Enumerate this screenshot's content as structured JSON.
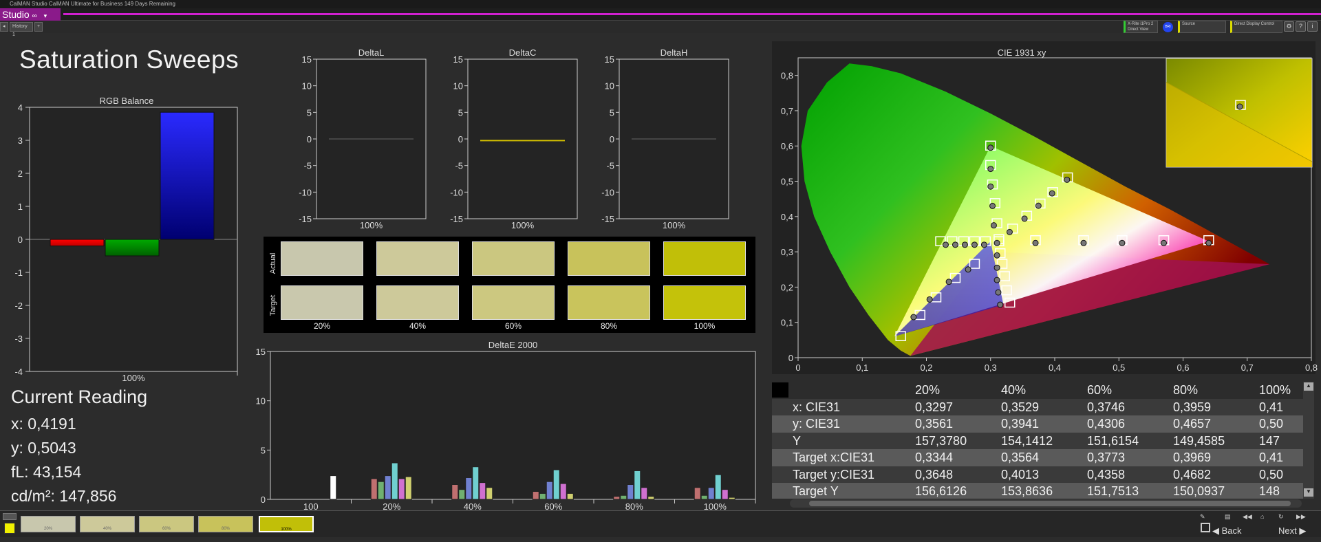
{
  "window": {
    "title": "CalMAN Studio CalMAN Ultimate for Business 149 Days Remaining",
    "app_label": "Studio",
    "history_tab": "History 1",
    "add_tab": "+"
  },
  "toolbar": {
    "meter": "X-Rite i1Pro 2",
    "meter_view": "Direct View",
    "source": "Source",
    "display": "Direct Display Control",
    "meter_badge": "BRI",
    "colors": {
      "meter": "#33cc33",
      "source": "#dddd00",
      "display": "#dddd00",
      "badge": "#2244ee"
    }
  },
  "page_title": "Saturation Sweeps",
  "current_reading": {
    "heading": "Current Reading",
    "x": "x: 0,4191",
    "y": "y: 0,5043",
    "fL": "fL: 43,154",
    "cdm2": "cd/m²: 147,856"
  },
  "swatch_labels": {
    "actual": "Actual",
    "target": "Target"
  },
  "charts": {
    "rgb": {
      "title": "RGB Balance",
      "yticks": [
        "4",
        "3",
        "2",
        "1",
        "0",
        "-1",
        "-2",
        "-3",
        "-4"
      ],
      "xlabel": "100%"
    },
    "deltaL": {
      "title": "DeltaL",
      "xlabel": "100%"
    },
    "deltaC": {
      "title": "DeltaC",
      "xlabel": "100%"
    },
    "deltaH": {
      "title": "DeltaH",
      "xlabel": "100%"
    },
    "deltaE": {
      "title": "DeltaE 2000",
      "yticks": [
        "15",
        "10",
        "5",
        "0"
      ],
      "xlabels": [
        "100",
        "20%",
        "40%",
        "60%",
        "80%",
        "100%"
      ]
    },
    "cie": {
      "title": "CIE 1931 xy",
      "xticks": [
        "0",
        "0,1",
        "0,2",
        "0,3",
        "0,4",
        "0,5",
        "0,6",
        "0,7",
        "0,8"
      ],
      "yticks": [
        "0,8",
        "0,7",
        "0,6",
        "0,5",
        "0,4",
        "0,3",
        "0,2",
        "0,1",
        "0"
      ]
    },
    "dticks": [
      "15",
      "10",
      "5",
      "0",
      "-5",
      "-10",
      "-15"
    ]
  },
  "chart_data": [
    {
      "type": "bar",
      "title": "RGB Balance",
      "categories": [
        "Red",
        "Green",
        "Blue"
      ],
      "values": [
        -0.2,
        -0.5,
        3.85
      ],
      "colors": [
        "#ff0000",
        "#00a000",
        "#0000ff"
      ],
      "ylim": [
        -4,
        4
      ],
      "xlabel": "100%"
    },
    {
      "type": "line",
      "title": "DeltaL",
      "x": [
        "100%"
      ],
      "values": [
        0
      ],
      "ylim": [
        -15,
        15
      ]
    },
    {
      "type": "line",
      "title": "DeltaC",
      "x": [
        "100%"
      ],
      "values": [
        -0.3
      ],
      "ylim": [
        -15,
        15
      ],
      "color": "#d4c000"
    },
    {
      "type": "line",
      "title": "DeltaH",
      "x": [
        "100%"
      ],
      "values": [
        0
      ],
      "ylim": [
        -15,
        15
      ]
    },
    {
      "type": "bar",
      "title": "DeltaE 2000",
      "categories": [
        "100",
        "20%",
        "40%",
        "60%",
        "80%",
        "100%"
      ],
      "ylim": [
        0,
        15
      ],
      "series": [
        {
          "color": "#ffffff",
          "values": [
            2.4,
            null,
            null,
            null,
            null,
            null
          ]
        },
        {
          "color": "#c07070",
          "values": [
            null,
            2.1,
            1.5,
            0.8,
            0.3,
            1.2
          ]
        },
        {
          "color": "#70b070",
          "values": [
            null,
            1.8,
            1.0,
            0.6,
            0.4,
            0.4
          ]
        },
        {
          "color": "#7080d0",
          "values": [
            null,
            2.4,
            2.2,
            1.8,
            1.5,
            1.2
          ]
        },
        {
          "color": "#70d0d0",
          "values": [
            null,
            3.7,
            3.3,
            3.0,
            2.9,
            2.5
          ]
        },
        {
          "color": "#d070d0",
          "values": [
            null,
            2.1,
            1.7,
            1.6,
            1.2,
            1.0
          ]
        },
        {
          "color": "#d0d070",
          "values": [
            null,
            2.3,
            1.2,
            0.6,
            0.3,
            0.2
          ]
        }
      ]
    },
    {
      "type": "scatter",
      "title": "CIE 1931 xy",
      "xlim": [
        0,
        0.8
      ],
      "ylim": [
        0,
        0.85
      ],
      "inset": "zoomed view around the current measured point",
      "current": {
        "x": 0.4191,
        "y": 0.5043
      },
      "targets": [
        [
          0.3,
          0.6
        ],
        [
          0.3,
          0.545
        ],
        [
          0.303,
          0.49
        ],
        [
          0.307,
          0.437
        ],
        [
          0.31,
          0.38
        ],
        [
          0.313,
          0.335
        ],
        [
          0.16,
          0.06
        ],
        [
          0.19,
          0.12
        ],
        [
          0.215,
          0.17
        ],
        [
          0.245,
          0.225
        ],
        [
          0.275,
          0.265
        ],
        [
          0.222,
          0.329
        ],
        [
          0.24,
          0.329
        ],
        [
          0.258,
          0.329
        ],
        [
          0.275,
          0.329
        ],
        [
          0.292,
          0.329
        ],
        [
          0.313,
          0.329
        ],
        [
          0.37,
          0.332
        ],
        [
          0.445,
          0.332
        ],
        [
          0.505,
          0.332
        ],
        [
          0.57,
          0.332
        ],
        [
          0.64,
          0.332
        ],
        [
          0.33,
          0.155
        ],
        [
          0.325,
          0.19
        ],
        [
          0.322,
          0.23
        ],
        [
          0.318,
          0.265
        ],
        [
          0.315,
          0.295
        ],
        [
          0.3344,
          0.3648
        ],
        [
          0.3564,
          0.4013
        ],
        [
          0.3773,
          0.4358
        ],
        [
          0.3969,
          0.4682
        ],
        [
          0.42,
          0.51
        ]
      ],
      "measured": [
        [
          0.3,
          0.595
        ],
        [
          0.3,
          0.535
        ],
        [
          0.3,
          0.485
        ],
        [
          0.303,
          0.43
        ],
        [
          0.305,
          0.375
        ],
        [
          0.31,
          0.325
        ],
        [
          0.18,
          0.115
        ],
        [
          0.205,
          0.165
        ],
        [
          0.235,
          0.215
        ],
        [
          0.265,
          0.25
        ],
        [
          0.23,
          0.32
        ],
        [
          0.245,
          0.32
        ],
        [
          0.26,
          0.32
        ],
        [
          0.275,
          0.32
        ],
        [
          0.29,
          0.32
        ],
        [
          0.37,
          0.325
        ],
        [
          0.445,
          0.325
        ],
        [
          0.505,
          0.325
        ],
        [
          0.57,
          0.325
        ],
        [
          0.64,
          0.325
        ],
        [
          0.315,
          0.15
        ],
        [
          0.312,
          0.185
        ],
        [
          0.31,
          0.22
        ],
        [
          0.31,
          0.255
        ],
        [
          0.31,
          0.29
        ],
        [
          0.3297,
          0.3561
        ],
        [
          0.3529,
          0.3941
        ],
        [
          0.3746,
          0.4306
        ],
        [
          0.3959,
          0.4657
        ],
        [
          0.4191,
          0.5043
        ]
      ]
    },
    {
      "type": "table",
      "columns": [
        "",
        "20%",
        "40%",
        "60%",
        "80%",
        "100%"
      ],
      "rows": [
        [
          "x: CIE31",
          "0,3297",
          "0,3529",
          "0,3746",
          "0,3959",
          "0,41"
        ],
        [
          "y: CIE31",
          "0,3561",
          "0,3941",
          "0,4306",
          "0,4657",
          "0,50"
        ],
        [
          "Y",
          "157,3780",
          "154,1412",
          "151,6154",
          "149,4585",
          "147"
        ],
        [
          "Target x:CIE31",
          "0,3344",
          "0,3564",
          "0,3773",
          "0,3969",
          "0,41"
        ],
        [
          "Target y:CIE31",
          "0,3648",
          "0,4013",
          "0,4358",
          "0,4682",
          "0,50"
        ],
        [
          "Target Y",
          "156,6126",
          "153,8636",
          "151,7513",
          "150,0937",
          "148"
        ]
      ]
    }
  ],
  "swatches": {
    "labels": [
      "20%",
      "40%",
      "60%",
      "80%",
      "100%"
    ],
    "actual": [
      "#c8c7ad",
      "#cdc99a",
      "#cbc780",
      "#c8c25b",
      "#c1bf08"
    ],
    "target": [
      "#c9c8ad",
      "#cdc99a",
      "#ccc880",
      "#c9c45c",
      "#c4c20a"
    ]
  },
  "bottom": {
    "swatches": [
      "20%",
      "40%",
      "60%",
      "80%",
      "100%"
    ],
    "swatch_colors": [
      "#c8c7ad",
      "#cdc99a",
      "#cbc780",
      "#c8c25b",
      "#c1bf08"
    ],
    "back": "Back",
    "next": "Next"
  }
}
